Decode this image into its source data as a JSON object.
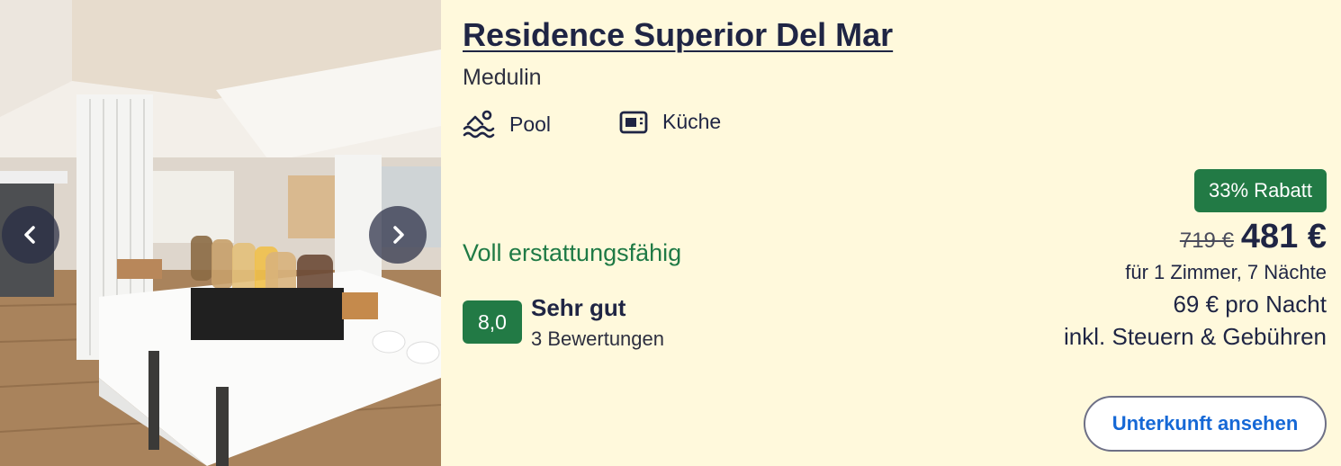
{
  "hotel": {
    "name": "Residence Superior Del Mar",
    "location": "Medulin"
  },
  "amenities": [
    {
      "icon": "pool-icon",
      "label": "Pool"
    },
    {
      "icon": "kitchen-icon",
      "label": "Küche"
    }
  ],
  "refund": {
    "label": "Voll erstattungsfähig",
    "color": "#1f7a45"
  },
  "rating": {
    "score": "8,0",
    "label": "Sehr gut",
    "reviews": "3 Bewertungen",
    "badge_color": "#227a45"
  },
  "price": {
    "discount": "33% Rabatt",
    "old": "719 €",
    "new": "481 €",
    "rooms_nights": "für 1 Zimmer, 7 Nächte",
    "per_night": "69 € pro Nacht",
    "taxes": "inkl. Steuern & Gebühren"
  },
  "cta": {
    "label": "Unterkunft ansehen",
    "color": "#1568d6"
  },
  "gallery": {
    "prev_icon": "chevron-left-icon",
    "next_icon": "chevron-right-icon"
  },
  "colors": {
    "background": "#fff9dc",
    "title": "#1f2544"
  }
}
